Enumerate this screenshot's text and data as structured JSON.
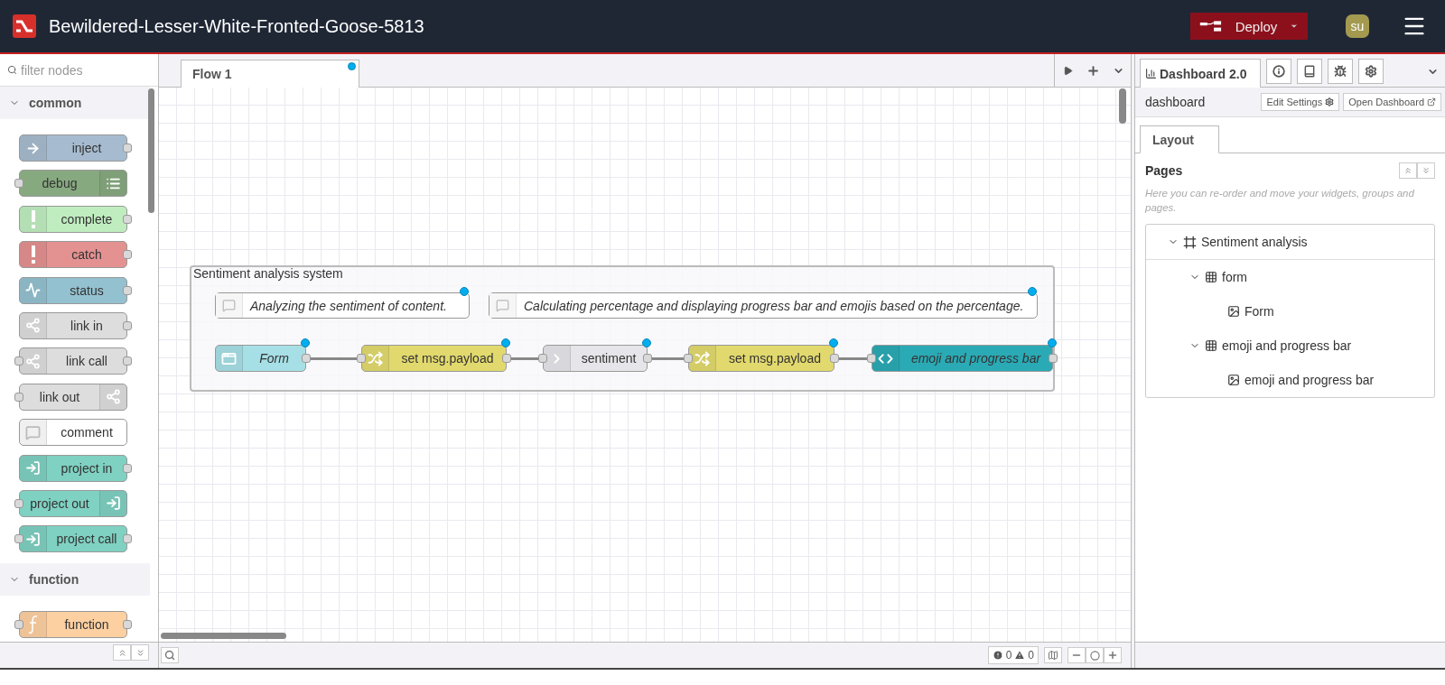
{
  "header": {
    "title": "Bewildered-Lesser-White-Fronted-Goose-5813",
    "deploy": "Deploy",
    "user": "su"
  },
  "palette": {
    "filter_placeholder": "filter nodes",
    "categories": [
      {
        "name": "common",
        "expanded": true,
        "nodes": [
          {
            "label": "inject",
            "kind": "inject",
            "color": "#a6bbcf",
            "inputs": false,
            "outputs": true
          },
          {
            "label": "debug",
            "kind": "debug",
            "color": "#87a980",
            "inputs": true,
            "outputs": false
          },
          {
            "label": "complete",
            "kind": "alert",
            "color": "#c0edc0",
            "inputs": false,
            "outputs": true
          },
          {
            "label": "catch",
            "kind": "alert",
            "color": "#e49191",
            "inputs": false,
            "outputs": true
          },
          {
            "label": "status",
            "kind": "status",
            "color": "#94c1d0",
            "inputs": false,
            "outputs": true
          },
          {
            "label": "link in",
            "kind": "link",
            "color": "#dddddd",
            "inputs": false,
            "outputs": true
          },
          {
            "label": "link call",
            "kind": "link",
            "color": "#dddddd",
            "inputs": true,
            "outputs": true
          },
          {
            "label": "link out",
            "kind": "link",
            "color": "#dddddd",
            "inputs": true,
            "outputs": false
          },
          {
            "label": "comment",
            "kind": "comment",
            "color": "#ffffff",
            "inputs": false,
            "outputs": false
          },
          {
            "label": "project in",
            "kind": "project",
            "color": "#7fd1c2",
            "inputs": false,
            "outputs": true
          },
          {
            "label": "project out",
            "kind": "project",
            "color": "#7fd1c2",
            "inputs": true,
            "outputs": false
          },
          {
            "label": "project call",
            "kind": "project",
            "color": "#7fd1c2",
            "inputs": true,
            "outputs": true
          }
        ]
      },
      {
        "name": "function",
        "expanded": true,
        "nodes": [
          {
            "label": "function",
            "kind": "function",
            "color": "#fdd0a2",
            "inputs": true,
            "outputs": true
          }
        ]
      }
    ]
  },
  "workspace": {
    "tabs": [
      {
        "label": "Flow 1",
        "selected": true,
        "changed": true
      }
    ],
    "group": {
      "label": "Sentiment analysis system"
    },
    "comments": [
      {
        "text": "Analyzing the sentiment of content.",
        "changed": true
      },
      {
        "text": "Calculating percentage and displaying progress bar and emojis based on the percentage.",
        "changed": true
      }
    ],
    "nodes": [
      {
        "label": "Form",
        "kind": "form",
        "color": "#a6e0e6",
        "italic": true,
        "changed": true,
        "inputs": false,
        "outputs": true
      },
      {
        "label": "set msg.payload",
        "kind": "change",
        "color": "#e2d96e",
        "italic": false,
        "changed": true,
        "inputs": true,
        "outputs": true
      },
      {
        "label": "sentiment",
        "kind": "analysis",
        "color": "#e6e6ea",
        "italic": false,
        "changed": true,
        "inputs": true,
        "outputs": true
      },
      {
        "label": "set msg.payload",
        "kind": "change",
        "color": "#e2d96e",
        "italic": false,
        "changed": true,
        "inputs": true,
        "outputs": true
      },
      {
        "label": "emoji and progress bar",
        "kind": "template",
        "color": "#2aaab5",
        "italic": true,
        "changed": true,
        "inputs": true,
        "outputs": true
      }
    ],
    "status": {
      "errors": "0",
      "warnings": "0"
    }
  },
  "sidebar": {
    "tabs": [
      {
        "label": "Dashboard 2.0",
        "selected": true
      }
    ],
    "toolbar": {
      "title": "dashboard",
      "buttons": [
        {
          "label": "Edit Settings",
          "kind": "settings"
        },
        {
          "label": "Open Dashboard",
          "kind": "external"
        }
      ]
    },
    "subtabs": [
      {
        "label": "Layout",
        "selected": true
      }
    ],
    "pages": {
      "title": "Pages",
      "hint": "Here you can re-order and move your widgets, groups and pages.",
      "tree": [
        {
          "label": "Sentiment analysis",
          "kind": "page",
          "expanded": true,
          "children": [
            {
              "label": "form",
              "kind": "group",
              "expanded": true,
              "children": [
                {
                  "label": "Form",
                  "kind": "widget"
                }
              ]
            },
            {
              "label": "emoji and progress bar",
              "kind": "group",
              "expanded": true,
              "children": [
                {
                  "label": "emoji and progress bar",
                  "kind": "widget"
                }
              ]
            }
          ]
        }
      ]
    }
  }
}
